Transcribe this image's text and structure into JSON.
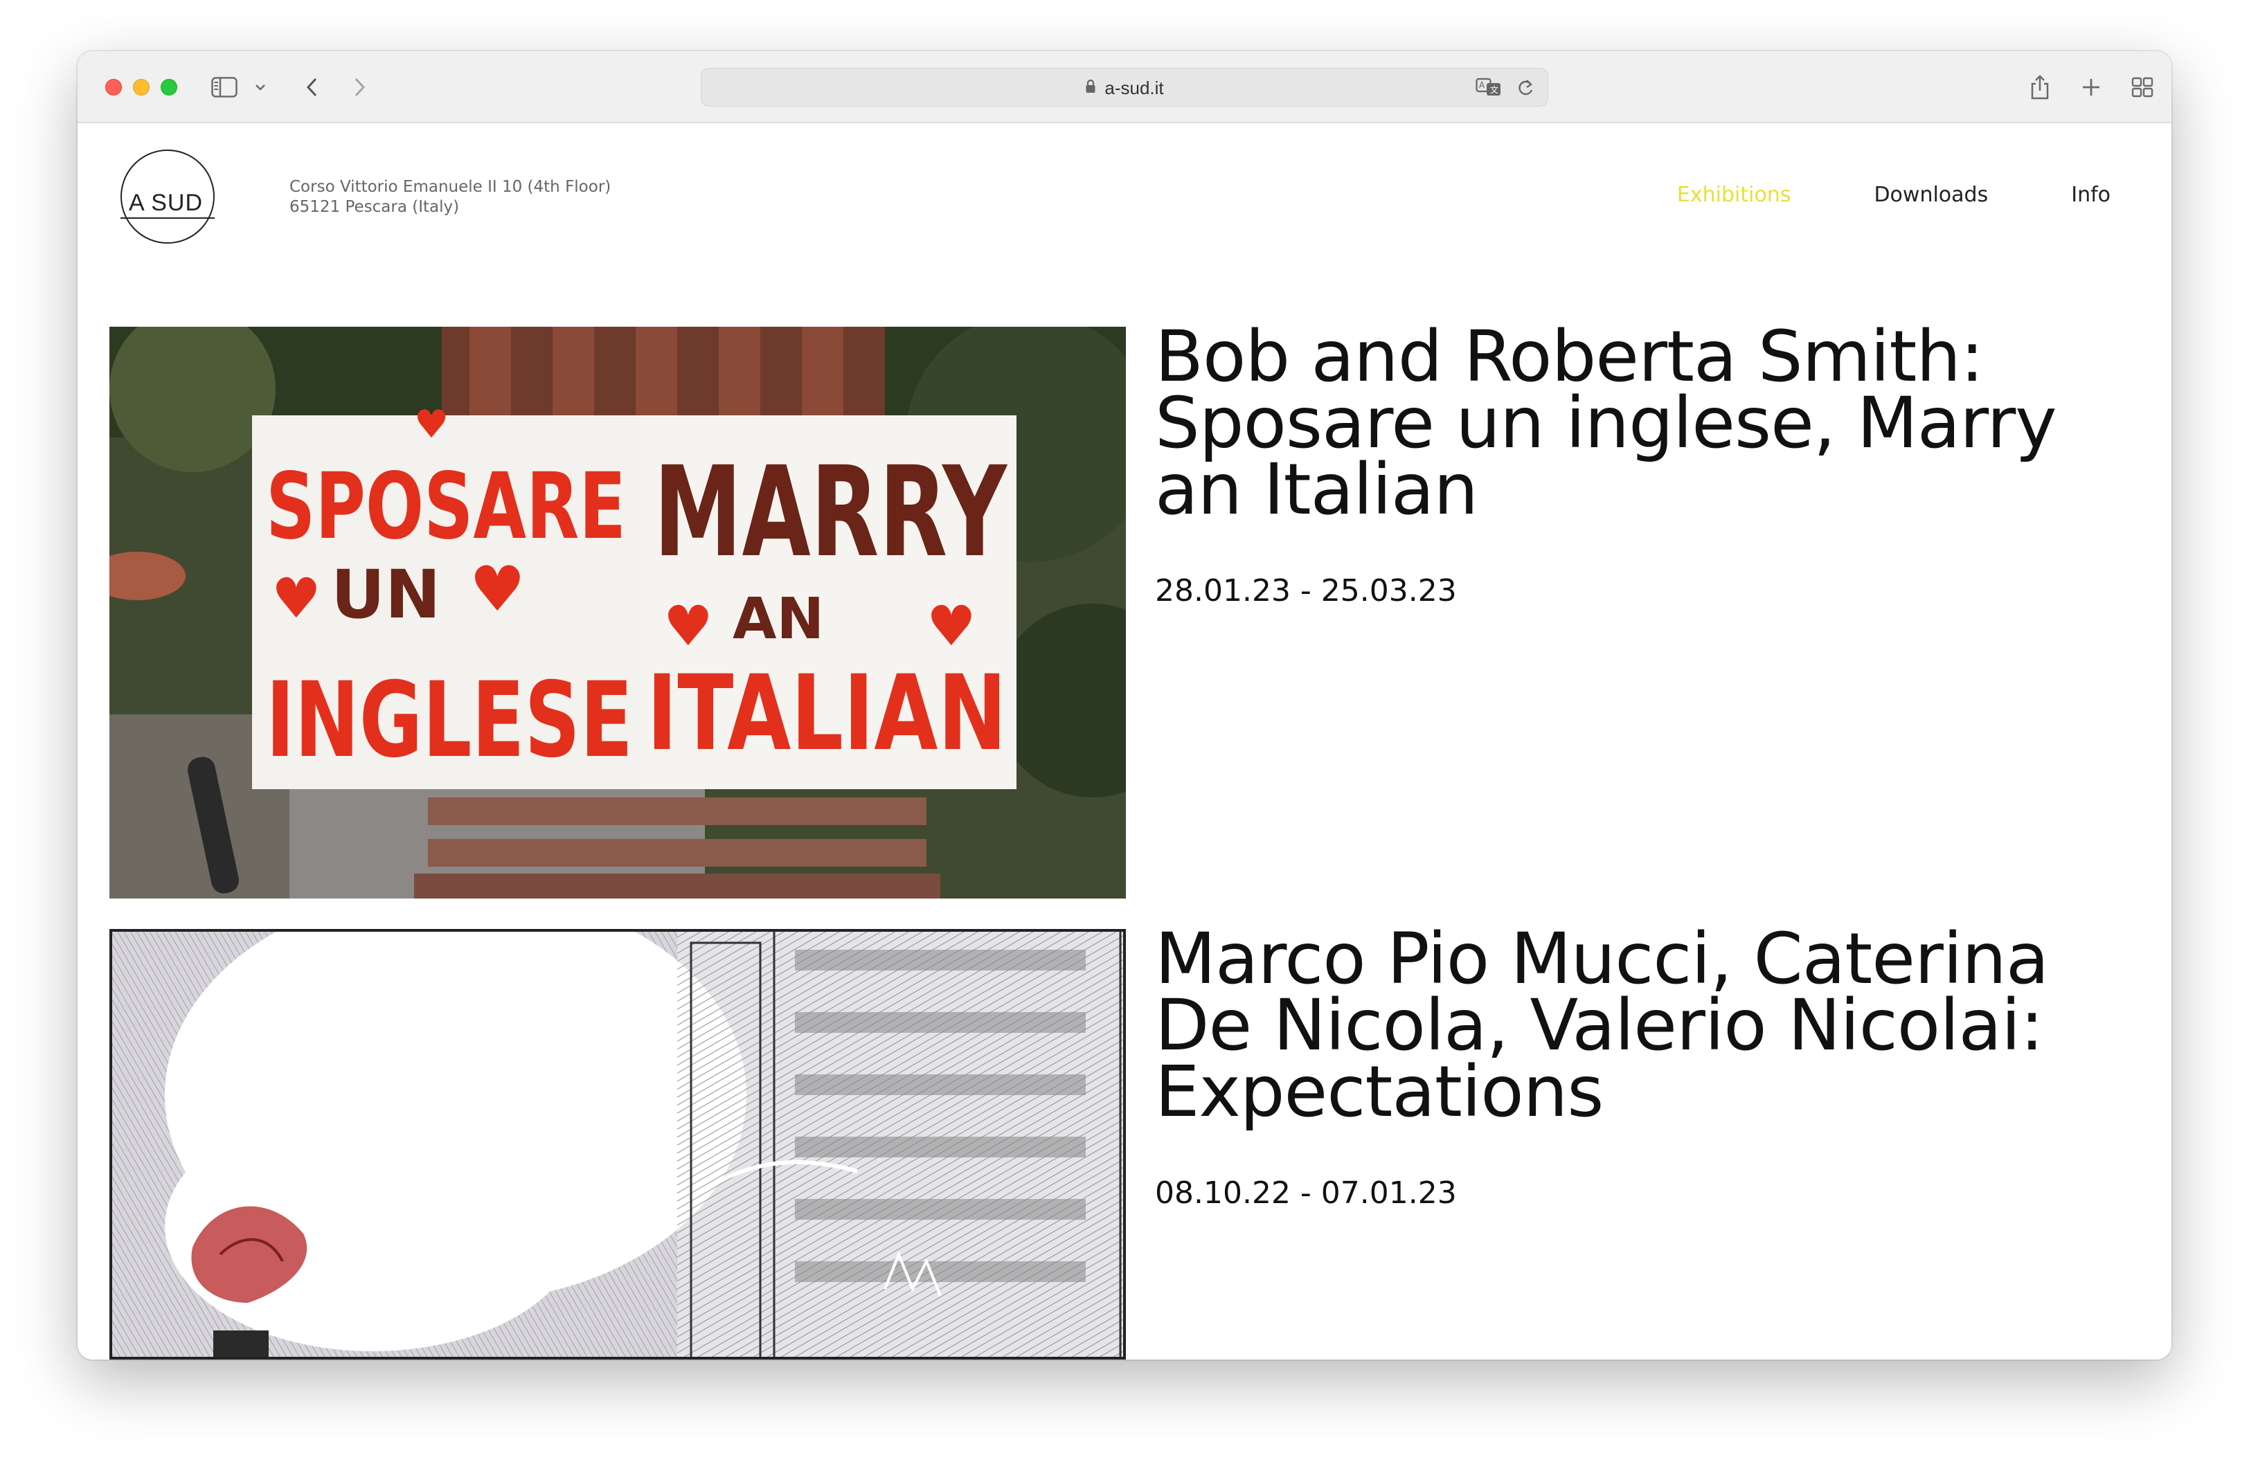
{
  "browser": {
    "url": "a-sud.it",
    "traffic_lights": [
      "close",
      "minimize",
      "zoom"
    ],
    "icons": [
      "sidebar-icon",
      "chevron-down-icon",
      "back-icon",
      "forward-icon",
      "lock-icon",
      "translate-icon",
      "reload-icon",
      "share-icon",
      "new-tab-icon",
      "tab-overview-icon"
    ]
  },
  "site": {
    "logo_text": "A SUD",
    "address_line1": "Corso Vittorio Emanuele II 10 (4th Floor)",
    "address_line2": "65121 Pescara (Italy)",
    "nav": [
      {
        "label": "Exhibitions",
        "active": true
      },
      {
        "label": "Downloads",
        "active": false
      },
      {
        "label": "Info",
        "active": false
      }
    ],
    "accent_color": "#e8e03a"
  },
  "exhibitions": [
    {
      "title": "Bob and Roberta Smith: Sposare un inglese, Marry an Italian",
      "dates": "28.01.23 - 25.03.23",
      "image_text": {
        "left_sign": [
          "SPOSARE",
          "UN",
          "INGLESE"
        ],
        "right_sign": [
          "MARRY",
          "AN",
          "ITALIAN"
        ]
      }
    },
    {
      "title": "Marco Pio Mucci, Caterina De Nicola, Valerio Nicolai: Expectations",
      "dates": "08.10.22 - 07.01.23"
    }
  ]
}
